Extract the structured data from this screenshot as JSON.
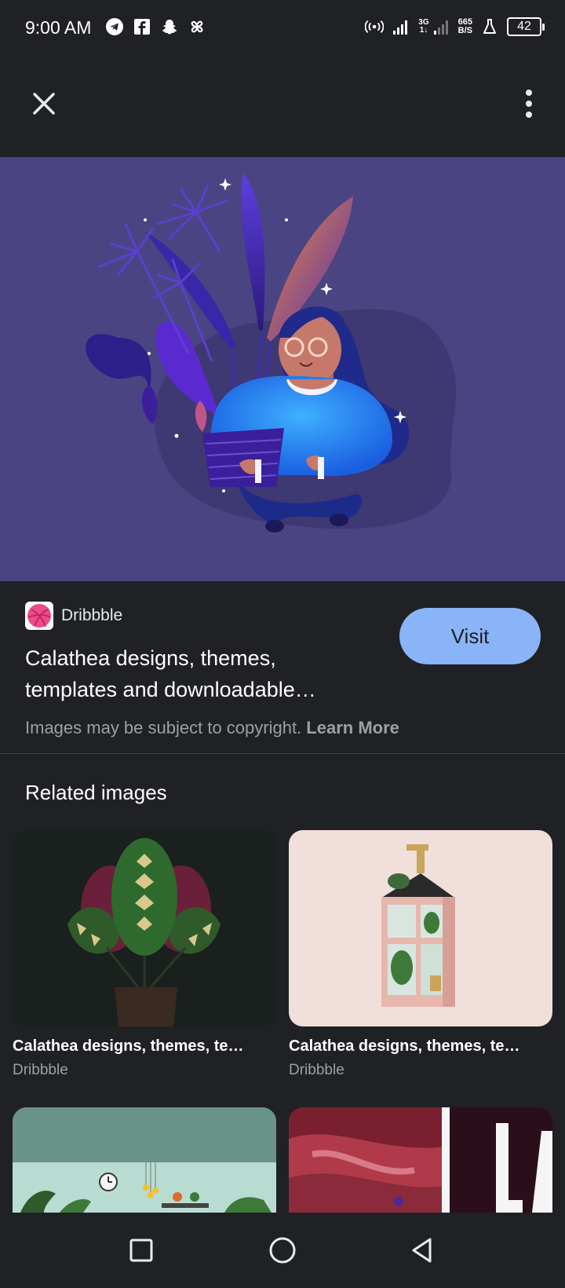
{
  "status_bar": {
    "time": "9:00 AM",
    "network_gen": "3G",
    "network_sub": "1↓",
    "speed_value": "665",
    "speed_unit": "B/S",
    "battery": "42"
  },
  "top_bar": {
    "close_icon": "close-icon",
    "more_icon": "more-vert-icon"
  },
  "source": {
    "site": "Dribbble",
    "title": "Calathea designs, themes, templates and downloadable…",
    "visit_label": "Visit",
    "copyright_text": "Images may be subject to copyright.",
    "learn_more": "Learn More"
  },
  "related": {
    "heading": "Related images",
    "items": [
      {
        "title": "Calathea designs, themes, te…",
        "source": "Dribbble"
      },
      {
        "title": "Calathea designs, themes, te…",
        "source": "Dribbble"
      }
    ]
  },
  "colors": {
    "background": "#202124",
    "accent": "#8ab4f8",
    "hero_bg": "#4a4482"
  }
}
